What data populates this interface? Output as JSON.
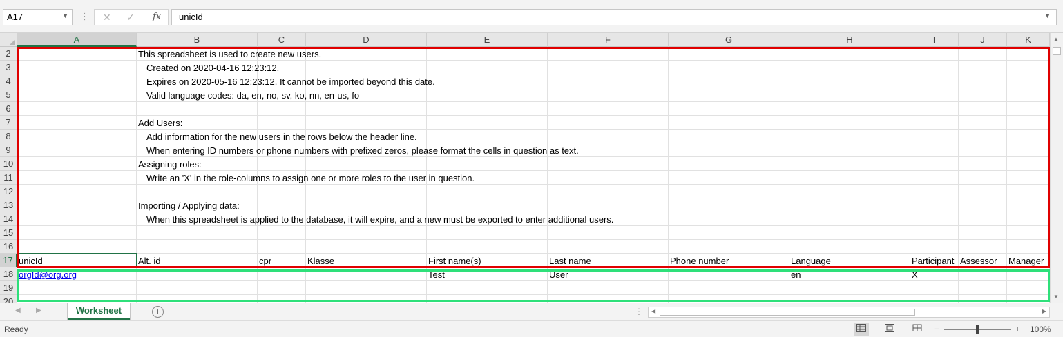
{
  "formula_bar": {
    "name_box": "A17",
    "cancel_icon": "✕",
    "confirm_icon": "✓",
    "fx_label": "fx",
    "content": "unicId"
  },
  "columns": [
    {
      "id": "A",
      "active": true
    },
    {
      "id": "B"
    },
    {
      "id": "C"
    },
    {
      "id": "D"
    },
    {
      "id": "E"
    },
    {
      "id": "F"
    },
    {
      "id": "G"
    },
    {
      "id": "H"
    },
    {
      "id": "I"
    },
    {
      "id": "J"
    },
    {
      "id": "K"
    }
  ],
  "rows": [
    {
      "num": "2",
      "cells": {
        "B": "This spreadsheet is used to create new users."
      }
    },
    {
      "num": "3",
      "cells": {
        "B": "Created on 2020-04-16 12:23:12."
      },
      "indent": [
        "B"
      ]
    },
    {
      "num": "4",
      "cells": {
        "B": "Expires on 2020-05-16 12:23:12. It cannot be imported beyond this date."
      },
      "indent": [
        "B"
      ]
    },
    {
      "num": "5",
      "cells": {
        "B": "Valid language codes: da, en, no, sv, ko, nn, en-us, fo"
      },
      "indent": [
        "B"
      ]
    },
    {
      "num": "6",
      "cells": {}
    },
    {
      "num": "7",
      "cells": {
        "B": "Add Users:"
      }
    },
    {
      "num": "8",
      "cells": {
        "B": "Add information for the new users in the rows below the header line."
      },
      "indent": [
        "B"
      ]
    },
    {
      "num": "9",
      "cells": {
        "B": "When entering ID numbers or phone numbers with prefixed zeros, please format the cells in question as text."
      },
      "indent": [
        "B"
      ]
    },
    {
      "num": "10",
      "cells": {
        "B": "Assigning roles:"
      }
    },
    {
      "num": "11",
      "cells": {
        "B": "Write an 'X' in the role-columns to assign one or more roles to the user in question."
      },
      "indent": [
        "B"
      ]
    },
    {
      "num": "12",
      "cells": {}
    },
    {
      "num": "13",
      "cells": {
        "B": "Importing / Applying data:"
      }
    },
    {
      "num": "14",
      "cells": {
        "B": "When this spreadsheet is applied to the database, it will expire, and a new must be exported to enter additional users."
      },
      "indent": [
        "B"
      ]
    },
    {
      "num": "15",
      "cells": {}
    },
    {
      "num": "16",
      "cells": {}
    },
    {
      "num": "17",
      "active": true,
      "cells": {
        "A": "unicId",
        "B": "Alt. id",
        "C": "cpr",
        "D": "Klasse",
        "E": "First name(s)",
        "F": "Last name",
        "G": "Phone number",
        "H": "Language",
        "I": "Participant",
        "J": "Assessor",
        "K": "Manager"
      }
    },
    {
      "num": "18",
      "cells": {
        "A": "orgId@org.org",
        "E": "Test",
        "F": "User",
        "H": "en",
        "I": "X"
      },
      "links": [
        "A"
      ]
    },
    {
      "num": "19",
      "cells": {}
    },
    {
      "num": "20",
      "cells": {}
    }
  ],
  "sheet_tabs": {
    "active": "Worksheet",
    "add_icon": "+"
  },
  "status_bar": {
    "status": "Ready",
    "zoom_minus": "−",
    "zoom_plus": "+",
    "zoom": "100%",
    "zoom_level_percent": 100
  },
  "icons": {
    "name_box_dropdown": "chevron-down-icon",
    "cancel": "close-icon",
    "confirm": "check-icon",
    "insert_function": "fx-icon",
    "formula_expand": "chevron-down-icon",
    "sheet_prev": "triangle-left-icon",
    "sheet_next": "triangle-right-icon",
    "add_sheet": "plus-circle-icon",
    "view_normal": "grid-view-icon",
    "view_page_layout": "page-layout-icon",
    "view_page_break": "page-break-icon"
  },
  "colors": {
    "accent": "#217346",
    "highlight_red": "#e00000",
    "highlight_green": "#2ee07a",
    "link": "#0000ee"
  }
}
